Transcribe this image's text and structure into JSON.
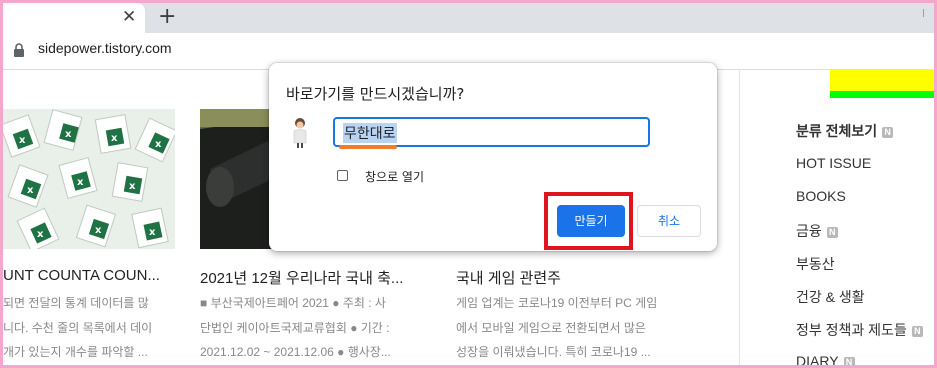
{
  "browser": {
    "tab_close_glyph": "✕",
    "new_tab_glyph": "+",
    "url": "sidepower.tistory.com"
  },
  "cards": [
    {
      "title": "UNT COUNTA COUN...",
      "lines": [
        "되면 전달의 통계 데이터를 많",
        "니다. 수천 줄의 목록에서 데이",
        "개가 있는지 개수를 파악할 ..."
      ]
    },
    {
      "title": "2021년 12월 우리나라 국내 축...",
      "lines": [
        "■ 부산국제아트페어 2021 ● 주최 : 사",
        "단법인 케이아트국제교류협회 ● 기간 :",
        "2021.12.02 ~ 2021.12.06 ● 행사장..."
      ]
    },
    {
      "title": "국내 게임 관련주",
      "lines": [
        "게임 업계는 코로나19 이전부터 PC 게임",
        "에서 모바일 게임으로 전환되면서 많은",
        "성장을 이뤄냈습니다. 특히 코로나19 ..."
      ]
    }
  ],
  "sidebar": {
    "new_badge": "N",
    "categories": [
      {
        "label": "분류 전체보기",
        "new": true
      },
      {
        "label": "HOT ISSUE",
        "new": false
      },
      {
        "label": "BOOKS",
        "new": false
      },
      {
        "label": "금융",
        "new": true
      },
      {
        "label": "부동산",
        "new": false
      },
      {
        "label": "건강 & 생활",
        "new": false
      },
      {
        "label": "정부 정책과 제도들",
        "new": true
      },
      {
        "label": "DIARY",
        "new": true
      }
    ]
  },
  "dialog": {
    "title": "바로가기를 만드시겠습니까?",
    "name_value": "무한대로",
    "open_as_window_label": "창으로 열기",
    "create_label": "만들기",
    "cancel_label": "취소"
  },
  "colors": {
    "accent": "#1a73e8",
    "highlight_box": "#e0141e",
    "page_border": "#f4a6cc"
  }
}
